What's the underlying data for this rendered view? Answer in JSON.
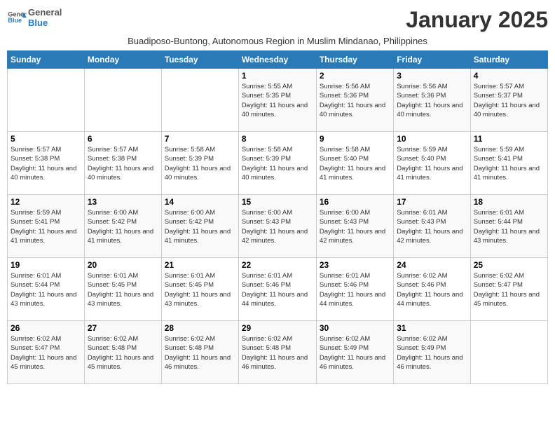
{
  "logo": {
    "general": "General",
    "blue": "Blue"
  },
  "title": "January 2025",
  "subtitle": "Buadiposo-Buntong, Autonomous Region in Muslim Mindanao, Philippines",
  "days_of_week": [
    "Sunday",
    "Monday",
    "Tuesday",
    "Wednesday",
    "Thursday",
    "Friday",
    "Saturday"
  ],
  "weeks": [
    [
      {
        "day": "",
        "sunrise": "",
        "sunset": "",
        "daylight": ""
      },
      {
        "day": "",
        "sunrise": "",
        "sunset": "",
        "daylight": ""
      },
      {
        "day": "",
        "sunrise": "",
        "sunset": "",
        "daylight": ""
      },
      {
        "day": "1",
        "sunrise": "Sunrise: 5:55 AM",
        "sunset": "Sunset: 5:35 PM",
        "daylight": "Daylight: 11 hours and 40 minutes."
      },
      {
        "day": "2",
        "sunrise": "Sunrise: 5:56 AM",
        "sunset": "Sunset: 5:36 PM",
        "daylight": "Daylight: 11 hours and 40 minutes."
      },
      {
        "day": "3",
        "sunrise": "Sunrise: 5:56 AM",
        "sunset": "Sunset: 5:36 PM",
        "daylight": "Daylight: 11 hours and 40 minutes."
      },
      {
        "day": "4",
        "sunrise": "Sunrise: 5:57 AM",
        "sunset": "Sunset: 5:37 PM",
        "daylight": "Daylight: 11 hours and 40 minutes."
      }
    ],
    [
      {
        "day": "5",
        "sunrise": "Sunrise: 5:57 AM",
        "sunset": "Sunset: 5:38 PM",
        "daylight": "Daylight: 11 hours and 40 minutes."
      },
      {
        "day": "6",
        "sunrise": "Sunrise: 5:57 AM",
        "sunset": "Sunset: 5:38 PM",
        "daylight": "Daylight: 11 hours and 40 minutes."
      },
      {
        "day": "7",
        "sunrise": "Sunrise: 5:58 AM",
        "sunset": "Sunset: 5:39 PM",
        "daylight": "Daylight: 11 hours and 40 minutes."
      },
      {
        "day": "8",
        "sunrise": "Sunrise: 5:58 AM",
        "sunset": "Sunset: 5:39 PM",
        "daylight": "Daylight: 11 hours and 40 minutes."
      },
      {
        "day": "9",
        "sunrise": "Sunrise: 5:58 AM",
        "sunset": "Sunset: 5:40 PM",
        "daylight": "Daylight: 11 hours and 41 minutes."
      },
      {
        "day": "10",
        "sunrise": "Sunrise: 5:59 AM",
        "sunset": "Sunset: 5:40 PM",
        "daylight": "Daylight: 11 hours and 41 minutes."
      },
      {
        "day": "11",
        "sunrise": "Sunrise: 5:59 AM",
        "sunset": "Sunset: 5:41 PM",
        "daylight": "Daylight: 11 hours and 41 minutes."
      }
    ],
    [
      {
        "day": "12",
        "sunrise": "Sunrise: 5:59 AM",
        "sunset": "Sunset: 5:41 PM",
        "daylight": "Daylight: 11 hours and 41 minutes."
      },
      {
        "day": "13",
        "sunrise": "Sunrise: 6:00 AM",
        "sunset": "Sunset: 5:42 PM",
        "daylight": "Daylight: 11 hours and 41 minutes."
      },
      {
        "day": "14",
        "sunrise": "Sunrise: 6:00 AM",
        "sunset": "Sunset: 5:42 PM",
        "daylight": "Daylight: 11 hours and 41 minutes."
      },
      {
        "day": "15",
        "sunrise": "Sunrise: 6:00 AM",
        "sunset": "Sunset: 5:43 PM",
        "daylight": "Daylight: 11 hours and 42 minutes."
      },
      {
        "day": "16",
        "sunrise": "Sunrise: 6:00 AM",
        "sunset": "Sunset: 5:43 PM",
        "daylight": "Daylight: 11 hours and 42 minutes."
      },
      {
        "day": "17",
        "sunrise": "Sunrise: 6:01 AM",
        "sunset": "Sunset: 5:43 PM",
        "daylight": "Daylight: 11 hours and 42 minutes."
      },
      {
        "day": "18",
        "sunrise": "Sunrise: 6:01 AM",
        "sunset": "Sunset: 5:44 PM",
        "daylight": "Daylight: 11 hours and 43 minutes."
      }
    ],
    [
      {
        "day": "19",
        "sunrise": "Sunrise: 6:01 AM",
        "sunset": "Sunset: 5:44 PM",
        "daylight": "Daylight: 11 hours and 43 minutes."
      },
      {
        "day": "20",
        "sunrise": "Sunrise: 6:01 AM",
        "sunset": "Sunset: 5:45 PM",
        "daylight": "Daylight: 11 hours and 43 minutes."
      },
      {
        "day": "21",
        "sunrise": "Sunrise: 6:01 AM",
        "sunset": "Sunset: 5:45 PM",
        "daylight": "Daylight: 11 hours and 43 minutes."
      },
      {
        "day": "22",
        "sunrise": "Sunrise: 6:01 AM",
        "sunset": "Sunset: 5:46 PM",
        "daylight": "Daylight: 11 hours and 44 minutes."
      },
      {
        "day": "23",
        "sunrise": "Sunrise: 6:01 AM",
        "sunset": "Sunset: 5:46 PM",
        "daylight": "Daylight: 11 hours and 44 minutes."
      },
      {
        "day": "24",
        "sunrise": "Sunrise: 6:02 AM",
        "sunset": "Sunset: 5:46 PM",
        "daylight": "Daylight: 11 hours and 44 minutes."
      },
      {
        "day": "25",
        "sunrise": "Sunrise: 6:02 AM",
        "sunset": "Sunset: 5:47 PM",
        "daylight": "Daylight: 11 hours and 45 minutes."
      }
    ],
    [
      {
        "day": "26",
        "sunrise": "Sunrise: 6:02 AM",
        "sunset": "Sunset: 5:47 PM",
        "daylight": "Daylight: 11 hours and 45 minutes."
      },
      {
        "day": "27",
        "sunrise": "Sunrise: 6:02 AM",
        "sunset": "Sunset: 5:48 PM",
        "daylight": "Daylight: 11 hours and 45 minutes."
      },
      {
        "day": "28",
        "sunrise": "Sunrise: 6:02 AM",
        "sunset": "Sunset: 5:48 PM",
        "daylight": "Daylight: 11 hours and 46 minutes."
      },
      {
        "day": "29",
        "sunrise": "Sunrise: 6:02 AM",
        "sunset": "Sunset: 5:48 PM",
        "daylight": "Daylight: 11 hours and 46 minutes."
      },
      {
        "day": "30",
        "sunrise": "Sunrise: 6:02 AM",
        "sunset": "Sunset: 5:49 PM",
        "daylight": "Daylight: 11 hours and 46 minutes."
      },
      {
        "day": "31",
        "sunrise": "Sunrise: 6:02 AM",
        "sunset": "Sunset: 5:49 PM",
        "daylight": "Daylight: 11 hours and 46 minutes."
      },
      {
        "day": "",
        "sunrise": "",
        "sunset": "",
        "daylight": ""
      }
    ]
  ]
}
